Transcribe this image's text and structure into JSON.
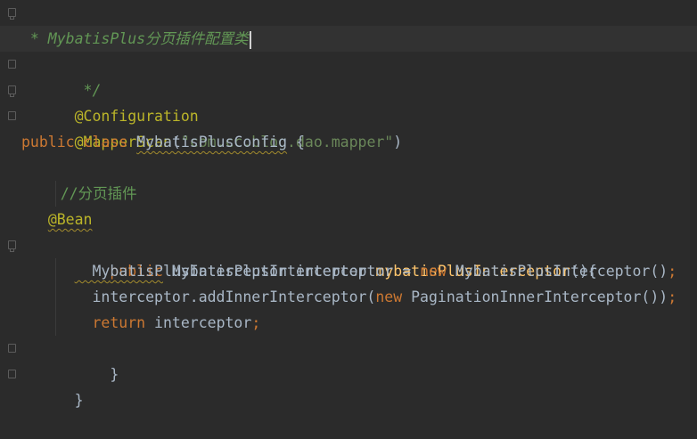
{
  "editor": {
    "language": "java",
    "theme_colors": {
      "background": "#2b2b2b",
      "keyword": "#cc7832",
      "annotation": "#bbb529",
      "string": "#6a8759",
      "comment": "#629755",
      "method": "#ffc66d",
      "text": "#a9b7c6"
    },
    "lines": {
      "l1": {
        "comment": "/**"
      },
      "l2": {
        "comment_prefix": " * MybatisPlus",
        "comment_cjk": "分页插件配置类"
      },
      "l3": {
        "comment": " */"
      },
      "l4": {
        "annotation": "@Configuration"
      },
      "l5": {
        "annotation": "@MapperScan",
        "paren_open": "(",
        "string": "\"com.cc.blog.dao.mapper\"",
        "paren_close": ")"
      },
      "l6": {
        "kw_public": "public",
        "kw_class": "class",
        "class_name": "MybatisPlusConfig",
        "brace": "{"
      },
      "l7": {},
      "l8": {
        "comment_slashes": "//",
        "comment_cjk": "分页插件"
      },
      "l9": {
        "annotation": "@Bean"
      },
      "l10": {
        "kw_public": "public",
        "return_type": "MybatisPlusInterceptor",
        "method": "mybatisPlusInterceptor",
        "rest": "(){"
      },
      "l11": {
        "type": "MybatisPlusInterceptor",
        "var": "interceptor",
        "eq": "=",
        "kw_new": "new",
        "ctor": "MybatisPlusInterceptor()",
        "semi": ";"
      },
      "l12": {
        "call": "interceptor.addInnerInterceptor(",
        "kw_new": "new",
        "ctor": "PaginationInnerInterceptor())",
        "semi": ";"
      },
      "l13": {
        "kw_return": "return",
        "value": "interceptor",
        "semi": ";"
      },
      "l14": {
        "brace": "}"
      },
      "l15": {
        "brace": "}"
      }
    }
  }
}
